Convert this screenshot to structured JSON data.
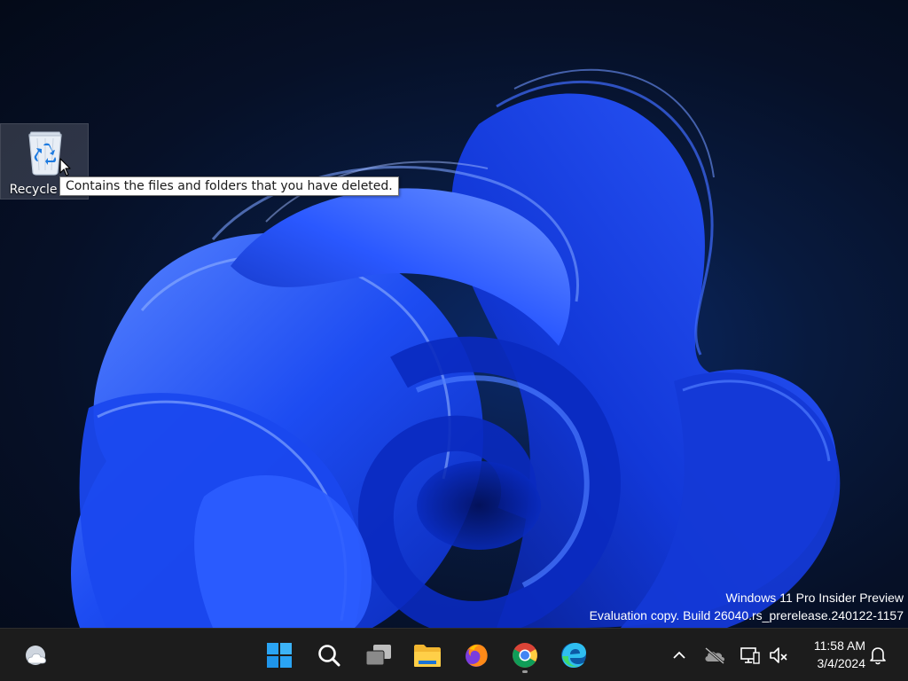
{
  "desktop": {
    "icons": [
      {
        "label": "Recycle Bin",
        "tooltip": "Contains the files and folders that you have deleted."
      }
    ],
    "watermark": {
      "line1": "Windows 11 Pro Insider Preview",
      "line2": "Evaluation copy. Build 26040.rs_prerelease.240122-1157"
    }
  },
  "taskbar": {
    "widgets_icon": "weather-cloud-icon",
    "apps": [
      {
        "name": "start-button",
        "icon": "windows-logo-icon"
      },
      {
        "name": "search-button",
        "icon": "search-icon"
      },
      {
        "name": "task-view-button",
        "icon": "task-view-icon"
      },
      {
        "name": "file-explorer-button",
        "icon": "folder-icon"
      },
      {
        "name": "firefox-button",
        "icon": "firefox-icon"
      },
      {
        "name": "chrome-button",
        "icon": "chrome-icon",
        "running": true
      },
      {
        "name": "edge-button",
        "icon": "edge-icon"
      }
    ],
    "tray": {
      "overflow_icon": "chevron-up-icon",
      "onedrive_icon": "cloud-offline-icon",
      "network_icon": "network-icon",
      "volume_icon": "volume-muted-icon",
      "notification_icon": "bell-icon"
    },
    "clock": {
      "time": "11:58 AM",
      "date": "3/4/2024"
    }
  },
  "colors": {
    "taskbar_bg": "#1c1c1c",
    "wallpaper_blue": "#1a4dff",
    "wallpaper_bg": "#061027"
  }
}
